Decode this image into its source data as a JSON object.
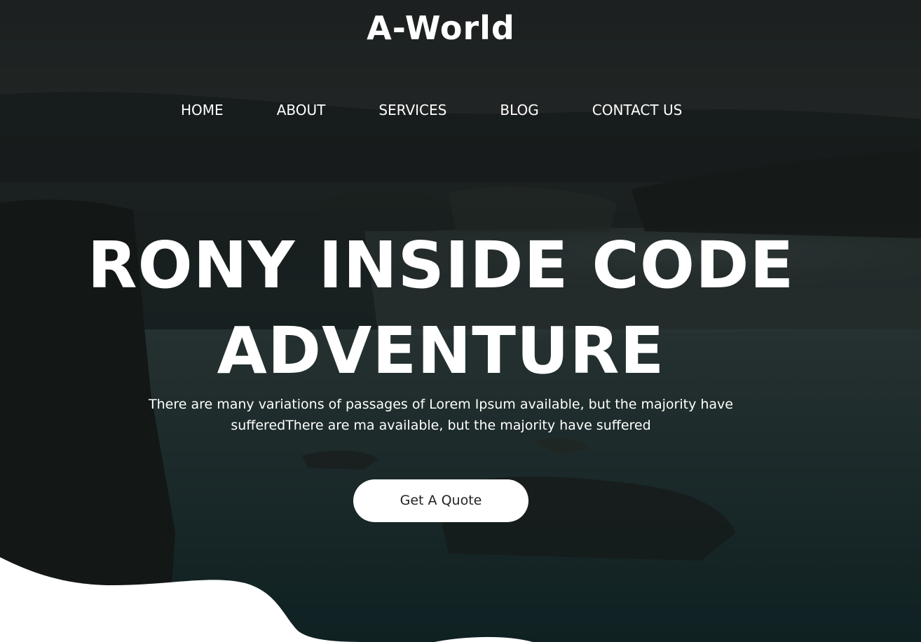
{
  "brand": {
    "logo_text": "A-World"
  },
  "nav": {
    "items": [
      {
        "label": "HOME"
      },
      {
        "label": "ABOUT"
      },
      {
        "label": "SERVICES"
      },
      {
        "label": "BLOG"
      },
      {
        "label": "CONTACT US"
      }
    ]
  },
  "hero": {
    "headline_line1": "RONY INSIDE CODE",
    "headline_line2": "ADVENTURE",
    "subtext": "There are many variations of passages of Lorem Ipsum available, but the majority have sufferedThere are ma available, but the majority have suffered",
    "cta_label": "Get A Quote"
  },
  "colors": {
    "text": "#ffffff",
    "button_bg": "#ffffff",
    "button_text": "#222222",
    "overlay": "#1a1f1f"
  }
}
